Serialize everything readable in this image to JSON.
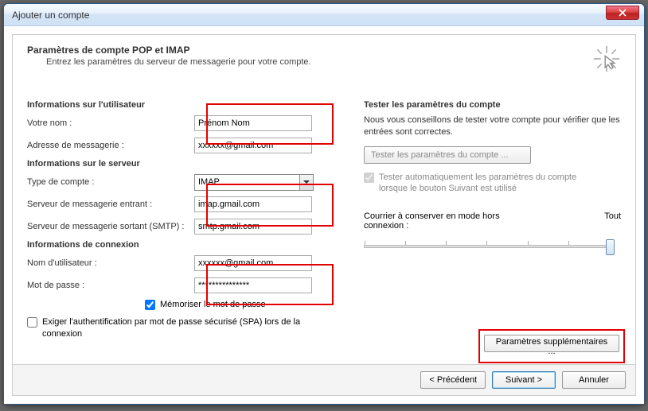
{
  "window": {
    "title": "Ajouter un compte"
  },
  "header": {
    "title": "Paramètres de compte POP et IMAP",
    "subtitle": "Entrez les paramètres du serveur de messagerie pour votre compte."
  },
  "user_info": {
    "heading": "Informations sur l'utilisateur",
    "name_label": "Votre nom :",
    "name_value": "Prénom Nom",
    "email_label": "Adresse de messagerie :",
    "email_value": "xxxxxx@gmail.com"
  },
  "server_info": {
    "heading": "Informations sur le serveur",
    "type_label": "Type de compte :",
    "type_value": "IMAP",
    "incoming_label": "Serveur de messagerie entrant :",
    "incoming_value": "imap.gmail.com",
    "outgoing_label": "Serveur de messagerie sortant (SMTP) :",
    "outgoing_value": "smtp.gmail.com"
  },
  "login_info": {
    "heading": "Informations de connexion",
    "user_label": "Nom d'utilisateur :",
    "user_value": "xxxxxx@gmail.com",
    "pass_label": "Mot de passe :",
    "pass_value": "***************",
    "remember_label": "Mémoriser le mot de passe",
    "spa_label": "Exiger l'authentification par mot de passe sécurisé (SPA) lors de la connexion"
  },
  "test": {
    "heading": "Tester les paramètres du compte",
    "desc": "Nous vous conseillons de tester votre compte pour vérifier que les entrées sont correctes.",
    "button": "Tester les paramètres du compte ...",
    "auto_label": "Tester automatiquement les paramètres du compte lorsque le bouton Suivant est utilisé"
  },
  "slider": {
    "label_left": "Courrier à conserver en mode hors connexion :",
    "label_right": "Tout"
  },
  "more_settings": {
    "button": "Paramètres supplémentaires ..."
  },
  "footer": {
    "back": "< Précédent",
    "next": "Suivant >",
    "cancel": "Annuler"
  }
}
